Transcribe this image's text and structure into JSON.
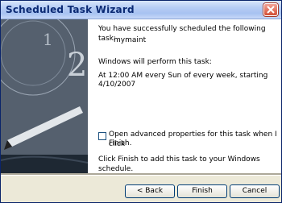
{
  "window": {
    "title": "Scheduled Task Wizard"
  },
  "message": {
    "success_line": "You have successfully scheduled the following task:",
    "task_name": "mymaint",
    "perform_line": "Windows will perform this task:",
    "schedule_line1": "At 12:00 AM every Sun of every week, starting",
    "schedule_line2": "4/10/2007"
  },
  "options": {
    "advanced_label_line1": "Open advanced properties for this task when I click",
    "advanced_label_line2": "Finish.",
    "advanced_checked": false
  },
  "instructions": {
    "finish_line": "Click Finish to add this task to your Windows schedule."
  },
  "buttons": {
    "back": "< Back",
    "finish": "Finish",
    "cancel": "Cancel"
  },
  "colors": {
    "titlebar_text": "#0b2a74",
    "close_red": "#d24e34",
    "dialog_bg": "#ece9d8"
  },
  "icons": {
    "close": "close-icon"
  }
}
